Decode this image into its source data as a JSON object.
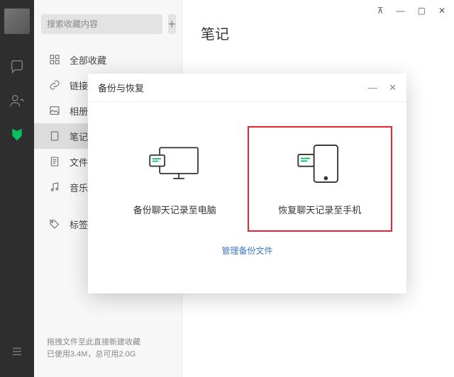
{
  "window": {
    "pin": "⊼",
    "min": "—",
    "max": "▢",
    "close": "✕"
  },
  "search": {
    "placeholder": "搜索收藏内容",
    "add": "+"
  },
  "sidebar": {
    "items": [
      {
        "label": "全部收藏"
      },
      {
        "label": "链接"
      },
      {
        "label": "相册"
      },
      {
        "label": "笔记"
      },
      {
        "label": "文件"
      },
      {
        "label": "音乐"
      },
      {
        "label": "标签"
      }
    ]
  },
  "main": {
    "title": "笔记"
  },
  "footer": {
    "line1": "拖拽文件至此直接新建收藏",
    "line2": "已使用3.4M，总可用2.0G"
  },
  "dialog": {
    "title": "备份与恢复",
    "option_backup": "备份聊天记录至电脑",
    "option_restore": "恢复聊天记录至手机",
    "manage": "管理备份文件",
    "min": "—",
    "close": "✕"
  }
}
